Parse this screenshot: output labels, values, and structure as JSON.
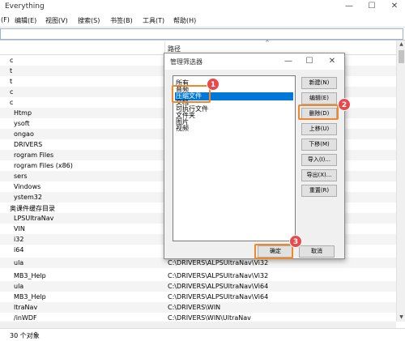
{
  "window": {
    "title": "Everything",
    "minimize": "—",
    "maximize": "☐",
    "close": "✕"
  },
  "menu": [
    "(F)",
    "编辑(E)",
    "视图(V)",
    "搜索(S)",
    "书签(B)",
    "工具(T)",
    "帮助(H)"
  ],
  "columns": {
    "path_header": "路径"
  },
  "rows": [
    {
      "name": "c",
      "path": ""
    },
    {
      "name": "t",
      "path": ""
    },
    {
      "name": "t",
      "path": ""
    },
    {
      "name": "c",
      "path": ""
    },
    {
      "name": "c",
      "path": ""
    },
    {
      "name": "Htmp",
      "path": ""
    },
    {
      "name": "ysoft",
      "path": ""
    },
    {
      "name": "ongao",
      "path": ""
    },
    {
      "name": "DRIVERS",
      "path": ""
    },
    {
      "name": "rogram Files",
      "path": ""
    },
    {
      "name": "rogram Files (x86)",
      "path": ""
    },
    {
      "name": "sers",
      "path": ""
    },
    {
      "name": "Vindows",
      "path": ""
    },
    {
      "name": "ystem32",
      "path": ""
    },
    {
      "name": "奥课件缓存目录",
      "path": ""
    },
    {
      "name": "LPSUltraNav",
      "path": ""
    },
    {
      "name": "VIN",
      "path": ""
    },
    {
      "name": "i32",
      "path": ""
    },
    {
      "name": "i64",
      "path": ""
    },
    {
      "name": "ula",
      "path": "C:\\DRIVERS\\ALPSUltraNav\\Vi32"
    },
    {
      "name": "MB3_Help",
      "path": "C:\\DRIVERS\\ALPSUltraNav\\Vi32"
    },
    {
      "name": "ula",
      "path": "C:\\DRIVERS\\ALPSUltraNav\\Vi64"
    },
    {
      "name": "MB3_Help",
      "path": "C:\\DRIVERS\\ALPSUltraNav\\Vi64"
    },
    {
      "name": "ltraNav",
      "path": "C:\\DRIVERS\\WIN"
    },
    {
      "name": "/inWDF",
      "path": "C:\\DRIVERS\\WIN\\UltraNav"
    }
  ],
  "status": {
    "text": "30 个对象"
  },
  "dialog": {
    "title": "管理筛选器",
    "minimize": "—",
    "maximize": "☐",
    "close": "✕",
    "filters": [
      "所有",
      "音频",
      "压缩文件",
      "文档",
      "可执行文件",
      "文件夹",
      "图片",
      "视频"
    ],
    "selected_index": 2,
    "buttons": {
      "new": "新建(N)",
      "edit": "编辑(E)",
      "delete": "删除(D)",
      "move_up": "上移(U)",
      "move_down": "下移(M)",
      "import": "导入(I)...",
      "export": "导出(X)...",
      "reset": "重置(R)",
      "ok": "确定",
      "cancel": "取消"
    }
  },
  "annotations": {
    "step1": "1",
    "step2": "2",
    "step3": "3",
    "color": "#f0882a",
    "badge_color": "#e8494d"
  }
}
